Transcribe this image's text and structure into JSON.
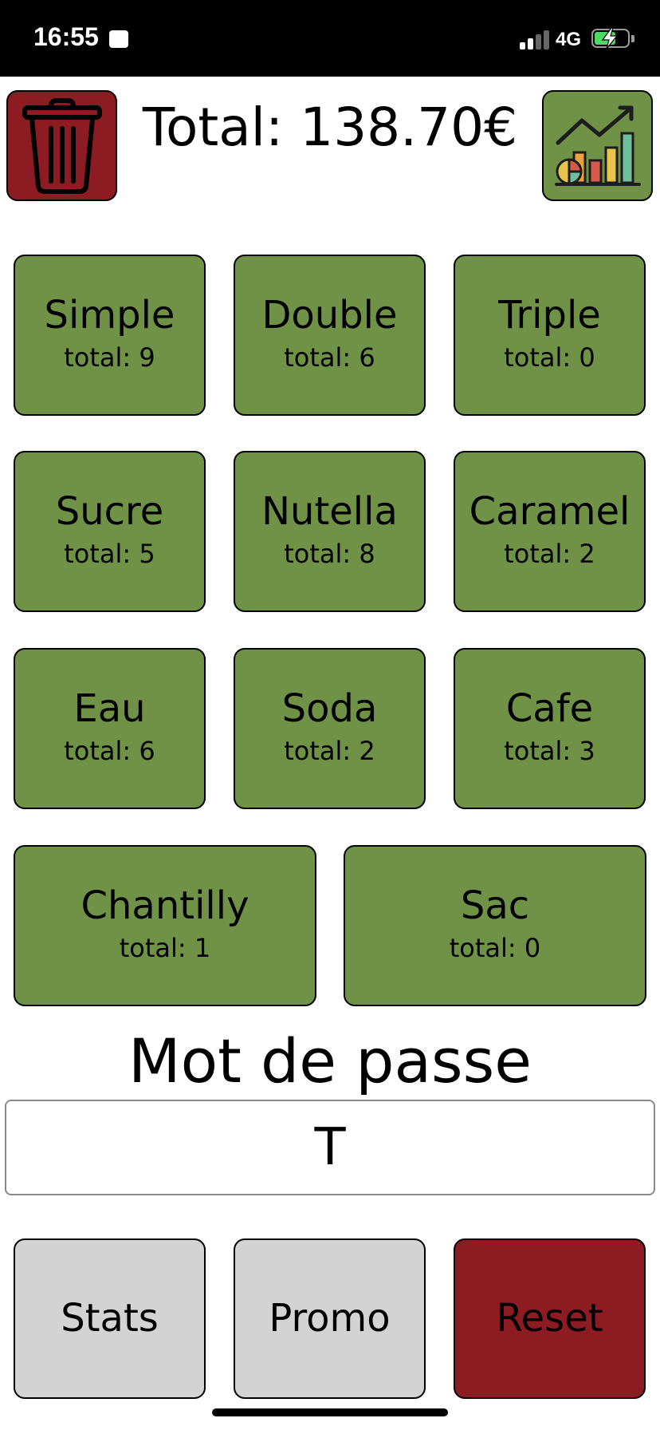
{
  "status_bar": {
    "time": "16:55",
    "network": "4G"
  },
  "header": {
    "total_text": "Total: 138.70€"
  },
  "products": [
    {
      "name": "Simple",
      "total": "total: 9"
    },
    {
      "name": "Double",
      "total": "total: 6"
    },
    {
      "name": "Triple",
      "total": "total: 0"
    },
    {
      "name": "Sucre",
      "total": "total: 5"
    },
    {
      "name": "Nutella",
      "total": "total: 8"
    },
    {
      "name": "Caramel",
      "total": "total: 2"
    },
    {
      "name": "Eau",
      "total": "total: 6"
    },
    {
      "name": "Soda",
      "total": "total: 2"
    },
    {
      "name": "Cafe",
      "total": "total: 3"
    },
    {
      "name": "Chantilly",
      "total": "total: 1"
    },
    {
      "name": "Sac",
      "total": "total: 0"
    }
  ],
  "password": {
    "label": "Mot de passe",
    "value": "T"
  },
  "buttons": {
    "stats": "Stats",
    "promo": "Promo",
    "reset": "Reset"
  },
  "colors": {
    "tile_green": "#6f9246",
    "danger_red": "#8d1c22",
    "neutral_grey": "#d3d3d3",
    "battery_green": "#4cd964"
  },
  "icons": {
    "trash": "trash-icon",
    "chart": "chart-icon"
  }
}
